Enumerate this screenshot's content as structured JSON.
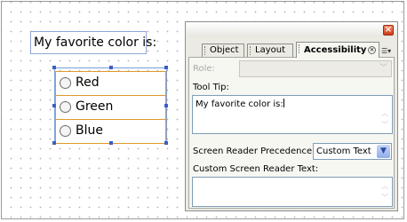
{
  "form": {
    "question": "My favorite color is:",
    "options": [
      "Red",
      "Green",
      "Blue"
    ]
  },
  "panel": {
    "close": "×",
    "tabs": [
      "Object",
      "Layout",
      "Accessibility"
    ],
    "active_tab_close": "×",
    "tab_menu": "☰▾",
    "role_label": "Role:",
    "tooltip_label": "Tool Tip:",
    "tooltip_value": "My favorite color is:",
    "precedence_label": "Screen Reader Precedence:",
    "precedence_value": "Custom Text",
    "custom_text_label": "Custom Screen Reader Text:",
    "custom_text_value": ""
  },
  "colors": {
    "selection_border": "#e09a2c",
    "handle": "#3a5fc8",
    "panel_bg": "#ecebe3"
  }
}
